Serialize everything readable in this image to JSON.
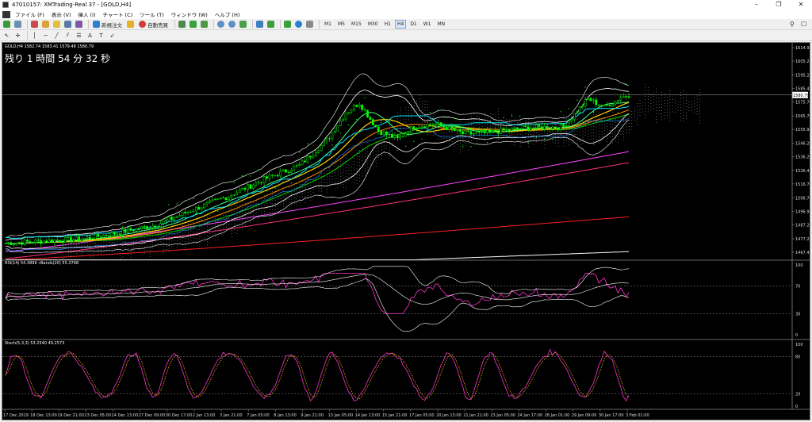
{
  "window": {
    "title": "47010157: XMTrading-Real 37 - [GOLD,H4]",
    "minimize": "–",
    "restore": "❐",
    "close": "✕"
  },
  "menu": [
    "ファイル (F)",
    "表示 (V)",
    "挿入 (I)",
    "チャート (C)",
    "ツール (T)",
    "ウィンドウ (W)",
    "ヘルプ (H)"
  ],
  "toolbar": {
    "new_order": "新規注文",
    "auto_trade": "自動売買",
    "timeframes": [
      "M1",
      "M5",
      "M15",
      "M30",
      "H1",
      "H4",
      "D1",
      "W1",
      "MN"
    ],
    "active_timeframe": "H4"
  },
  "chart": {
    "header": "GOLD,H4  1582.74 1583.41 1579.48 1580.79",
    "countdown": "残り 1 時間 54 分 32 秒",
    "current_price_label": "1580.79",
    "price_ticks": [
      "1614.95",
      "1605.25",
      "1595.20",
      "1585.45",
      "1575.70",
      "1565.70",
      "1555.95",
      "1546.20",
      "1536.20",
      "1526.45",
      "1516.70",
      "1506.70",
      "1496.95",
      "1487.20",
      "1477.20",
      "1467.45"
    ],
    "date_ticks": [
      "17 Dec 2019",
      "18 Dec 13:00",
      "19 Dec 21:00",
      "23 Dec 05:00",
      "24 Dec 13:00",
      "27 Dec 09:00",
      "30 Dec 17:00",
      "2 Jan 13:00",
      "3 Jan 21:00",
      "7 Jan 05:00",
      "8 Jan 13:00",
      "9 Jan 21:00",
      "13 Jan 05:00",
      "14 Jan 13:00",
      "15 Jan 21:00",
      "17 Jan 05:00",
      "20 Jan 13:00",
      "21 Jan 21:00",
      "23 Jan 05:00",
      "24 Jan 17:00",
      "28 Jan 01:00",
      "29 Jan 09:00",
      "30 Jan 17:00",
      "3 Feb 01:00"
    ]
  },
  "rsi": {
    "label": "RSI(14) 54.3896  »Bands(20) 55.2768",
    "ticks": [
      "100",
      "70",
      "30",
      "0"
    ]
  },
  "stoch": {
    "label": "Stoch(5,3,3) 53.2540 49.2573",
    "ticks": [
      "100",
      "80",
      "20",
      "0"
    ]
  },
  "colors": {
    "candle": "#00ff00",
    "bands": "#ffffff",
    "cloud": "#ffffff",
    "ma_cyan": "#00e5ff",
    "ma_yellow": "#ffd700",
    "ma_orange": "#ff8c00",
    "ma_green": "#00d700",
    "ma_magenta": "#ff44ff",
    "ma_red": "#ff2020",
    "rsi_line": "#ff33cc",
    "stoch_signal": "#ffcc00"
  }
}
